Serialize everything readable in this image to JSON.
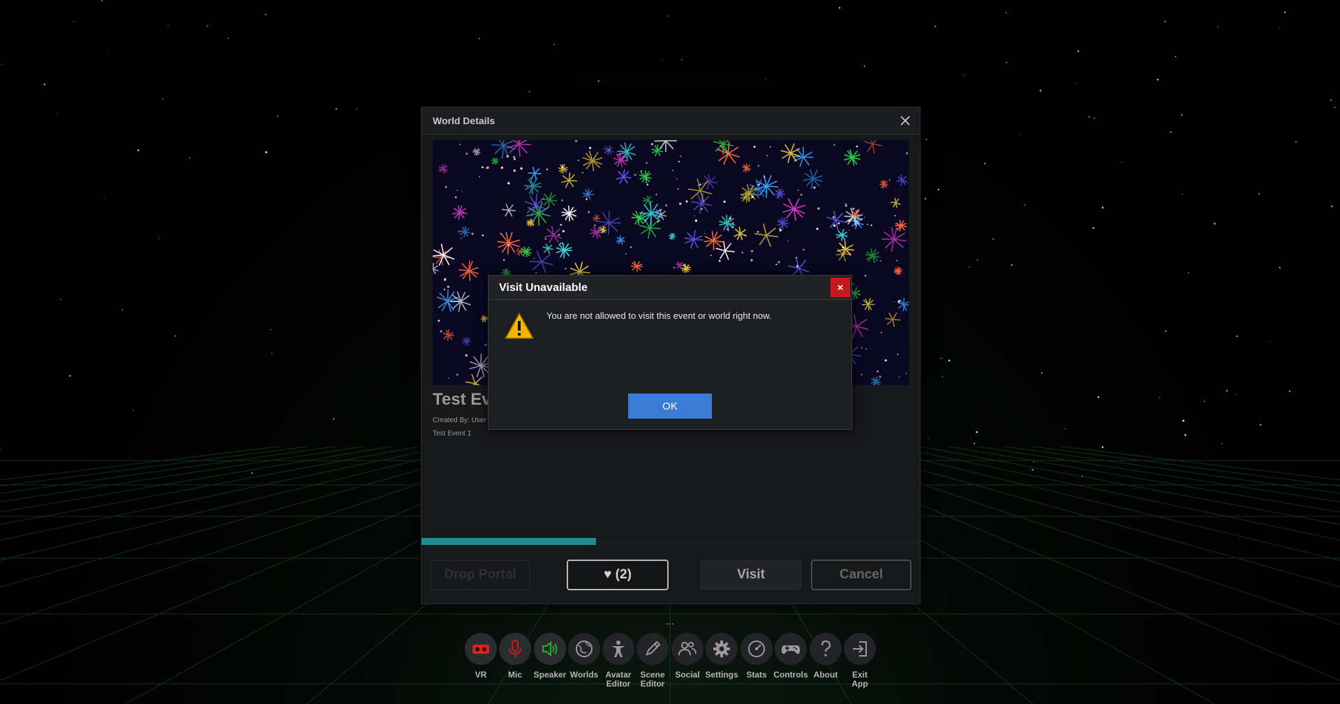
{
  "world_details": {
    "title": "World Details",
    "world_name": "Test Ev",
    "created_by": "Created By: User",
    "description": "Test Event 1",
    "progress_percent": 35,
    "buttons": {
      "drop_portal": "Drop Portal",
      "like": "♥ (2)",
      "visit": "Visit",
      "cancel": "Cancel"
    }
  },
  "dialog": {
    "title": "Visit Unavailable",
    "close_label": "×",
    "message": "You are not allowed to visit this event or world right now.",
    "ok_label": "OK"
  },
  "taskbar": {
    "more_label": "...",
    "items": [
      {
        "label": "VR",
        "icon": "vr-headset-icon",
        "color": "#e02020"
      },
      {
        "label": "Mic",
        "icon": "microphone-icon",
        "color": "#d01818"
      },
      {
        "label": "Speaker",
        "icon": "speaker-icon",
        "color": "#27b02a"
      },
      {
        "label": "Worlds",
        "icon": "globe-icon",
        "color": "#9a9a9a"
      },
      {
        "label": "Avatar\nEditor",
        "icon": "avatar-icon",
        "color": "#9a9a9a"
      },
      {
        "label": "Scene\nEditor",
        "icon": "pencil-icon",
        "color": "#9a9a9a"
      },
      {
        "label": "Social",
        "icon": "people-icon",
        "color": "#9a9a9a"
      },
      {
        "label": "Settings",
        "icon": "gear-icon",
        "color": "#9a9a9a"
      },
      {
        "label": "Stats",
        "icon": "gauge-icon",
        "color": "#9a9a9a"
      },
      {
        "label": "Controls",
        "icon": "gamepad-icon",
        "color": "#9a9a9a"
      },
      {
        "label": "About",
        "icon": "question-icon",
        "color": "#9a9a9a"
      },
      {
        "label": "Exit\nApp",
        "icon": "exit-icon",
        "color": "#9a9a9a"
      }
    ]
  }
}
